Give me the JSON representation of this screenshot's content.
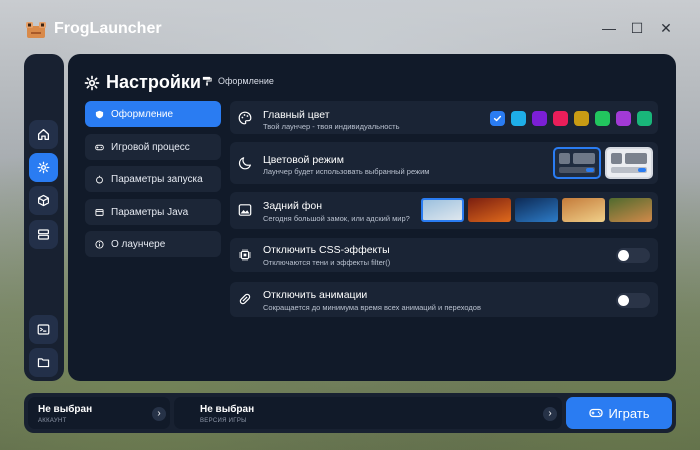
{
  "app": {
    "title": "FrogLauncher"
  },
  "window": {
    "minimize": "—",
    "maximize": "☐",
    "close": "✕"
  },
  "sidebar": {
    "items": [
      {
        "icon": "home-icon"
      },
      {
        "icon": "gear-icon",
        "active": true
      },
      {
        "icon": "cube-icon"
      },
      {
        "icon": "server-icon"
      },
      {
        "icon": "console-icon"
      },
      {
        "icon": "folder-icon"
      }
    ]
  },
  "header": {
    "title": "Настройки",
    "breadcrumb": "Оформление"
  },
  "tabs": [
    {
      "label": "Оформление",
      "icon": "palette-icon",
      "active": true
    },
    {
      "label": "Игровой процесс",
      "icon": "gamepad-icon"
    },
    {
      "label": "Параметры запуска",
      "icon": "rocket-icon"
    },
    {
      "label": "Параметры Java",
      "icon": "java-icon"
    },
    {
      "label": "О лаунчере",
      "icon": "info-icon"
    }
  ],
  "settings": {
    "accent": {
      "title": "Главный цвет",
      "subtitle": "Твой лаунчер - твоя индивидуальность",
      "colors": [
        "#2a7cf2",
        "#1eaee8",
        "#7b1fd6",
        "#e91e5a",
        "#c89b14",
        "#22c55e",
        "#a23ad6",
        "#19b67a"
      ],
      "selected_index": 0
    },
    "theme": {
      "title": "Цветовой режим",
      "subtitle": "Лаунчер будет использовать выбранный режим",
      "modes": [
        "dark",
        "light"
      ],
      "selected": "dark"
    },
    "background": {
      "title": "Задний фон",
      "subtitle": "Сегодня большой замок, или адский мир?",
      "thumbnails": [
        {
          "colors": [
            "#9cc0de",
            "#dfe7ee"
          ],
          "selected": true
        },
        {
          "colors": [
            "#7a1e10",
            "#e06a1c"
          ]
        },
        {
          "colors": [
            "#0d2a55",
            "#2d7cc8"
          ]
        },
        {
          "colors": [
            "#c47b3a",
            "#f0d08a"
          ]
        },
        {
          "colors": [
            "#4f6a2e",
            "#d28a4a"
          ]
        }
      ]
    },
    "css_effects": {
      "title": "Отключить CSS-эффекты",
      "subtitle": "Отключаются тени и эффекты filter()",
      "enabled": false
    },
    "animations": {
      "title": "Отключить анимации",
      "subtitle": "Сокращается до минимума время всех анимаций и переходов",
      "enabled": false
    }
  },
  "bottom": {
    "account": {
      "name": "Не выбран",
      "caption": "АККАУНТ",
      "chevron": "›"
    },
    "version": {
      "name": "Не выбран",
      "caption": "ВЕРСИЯ ИГРЫ",
      "chevron": "›"
    },
    "play_label": "Играть"
  }
}
